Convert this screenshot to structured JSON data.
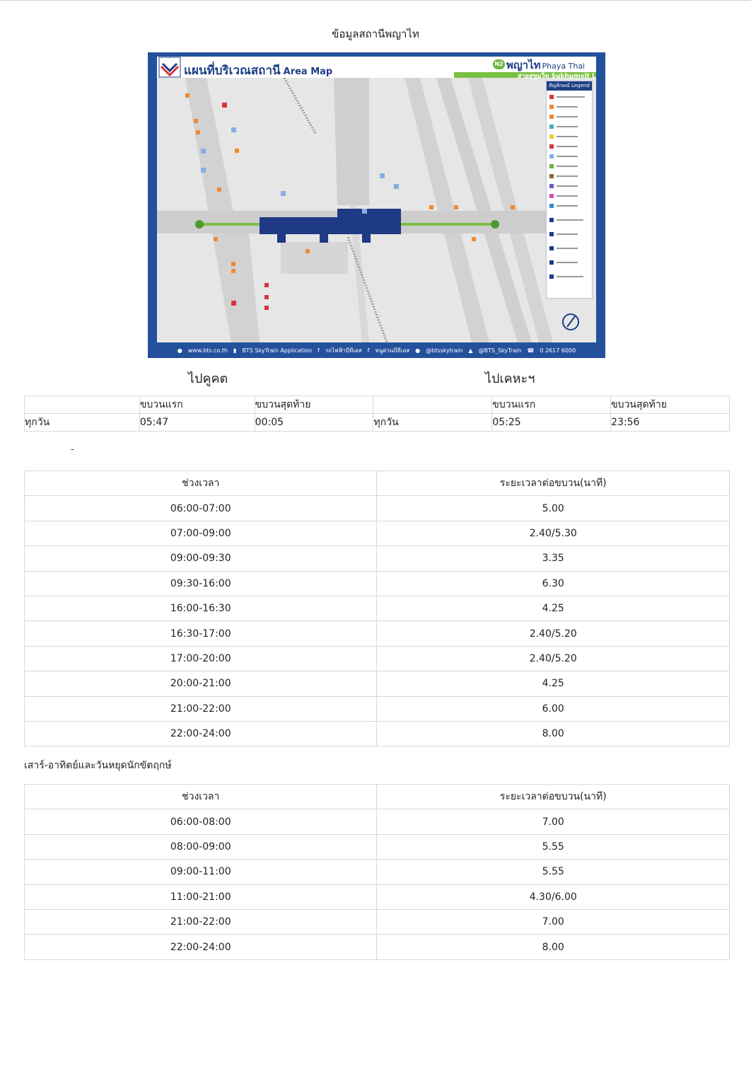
{
  "page": {
    "title": "ข้อมูลสถานีพญาไท"
  },
  "area_map": {
    "title_th": "แผนที่บริเวณสถานี",
    "title_en": "Area Map",
    "station_code": "N2",
    "station_th": "พญาไท",
    "station_en": "Phaya Thai",
    "line": "สายสุขุมวิท Sukhumvit Line",
    "legend_title": "สัญลักษณ์ Legend",
    "footer": {
      "website": "www.bts.co.th",
      "app": "BTS SkyTrain Application",
      "facebook1": "รถไฟฟ้าบีทีเอส",
      "facebook2": "หนูด่วนบีทีเอส",
      "line": "@btsskytrain",
      "twitter": "@BTS_SkyTrain",
      "phone": "0 2617 6000"
    },
    "colors": {
      "frame": "#24519c",
      "accent_green": "#7bc043",
      "track": "#1e3a84"
    }
  },
  "directions": {
    "left": "ไปคูคต",
    "right": "ไปเคหะฯ"
  },
  "first_last": {
    "headers": {
      "first": "ขบวนแรก",
      "last": "ขบวนสุดท้าย"
    },
    "left": {
      "day": "ทุกวัน",
      "first": "05:47",
      "last": "00:05"
    },
    "right": {
      "day": "ทุกวัน",
      "first": "05:25",
      "last": "23:56"
    }
  },
  "weekday_label": "-",
  "frequency_headers": {
    "time": "ช่วงเวลา",
    "interval": "ระยะเวลาต่อขบวน(นาที)"
  },
  "weekday": [
    {
      "time": "06:00-07:00",
      "interval": "5.00"
    },
    {
      "time": "07:00-09:00",
      "interval": "2.40/5.30"
    },
    {
      "time": "09:00-09:30",
      "interval": "3.35"
    },
    {
      "time": "09:30-16:00",
      "interval": "6.30"
    },
    {
      "time": "16:00-16:30",
      "interval": "4.25"
    },
    {
      "time": "16:30-17:00",
      "interval": "2.40/5.20"
    },
    {
      "time": "17:00-20:00",
      "interval": "2.40/5.20"
    },
    {
      "time": "20:00-21:00",
      "interval": "4.25"
    },
    {
      "time": "21:00-22:00",
      "interval": "6.00"
    },
    {
      "time": "22:00-24:00",
      "interval": "8.00"
    }
  ],
  "weekend_title": "เสาร์-อาทิตย์และวันหยุดนักขัตฤกษ์",
  "weekend": [
    {
      "time": "06:00-08:00",
      "interval": "7.00"
    },
    {
      "time": "08:00-09:00",
      "interval": "5.55"
    },
    {
      "time": "09:00-11:00",
      "interval": "5.55"
    },
    {
      "time": "11:00-21:00",
      "interval": "4.30/6.00"
    },
    {
      "time": "21:00-22:00",
      "interval": "7.00"
    },
    {
      "time": "22:00-24:00",
      "interval": "8.00"
    }
  ]
}
